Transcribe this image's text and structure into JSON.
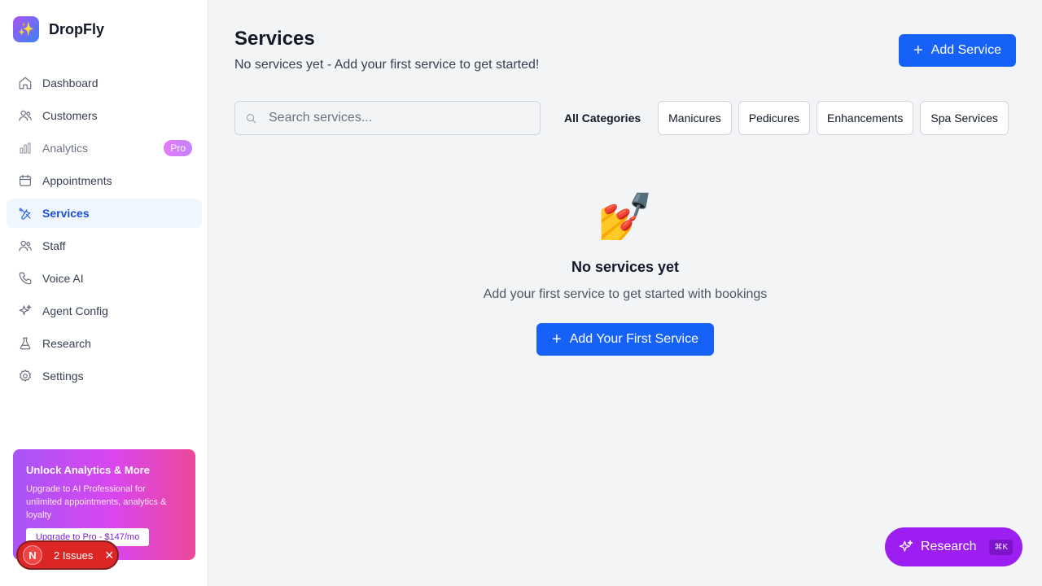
{
  "app": {
    "name": "DropFly",
    "logo_icon": "sparkles-icon"
  },
  "sidebar": {
    "items": [
      {
        "label": "Dashboard",
        "icon": "home-icon"
      },
      {
        "label": "Customers",
        "icon": "users-icon"
      },
      {
        "label": "Analytics",
        "icon": "bar-chart-icon",
        "badge": "Pro"
      },
      {
        "label": "Appointments",
        "icon": "calendar-icon"
      },
      {
        "label": "Services",
        "icon": "tools-icon",
        "active": true
      },
      {
        "label": "Staff",
        "icon": "users-icon"
      },
      {
        "label": "Voice AI",
        "icon": "phone-icon"
      },
      {
        "label": "Agent Config",
        "icon": "sparkles-icon"
      },
      {
        "label": "Research",
        "icon": "flask-icon"
      },
      {
        "label": "Settings",
        "icon": "gear-icon"
      }
    ],
    "upgrade": {
      "title": "Unlock Analytics & More",
      "text": "Upgrade to AI Professional for unlimited appointments, analytics & loyalty",
      "button": "Upgrade to Pro - $147/mo"
    },
    "issues": {
      "avatar": "N",
      "label": "2 Issues",
      "close": "✕"
    }
  },
  "header": {
    "title": "Services",
    "subtitle": "No services yet - Add your first service to get started!",
    "add_button": "Add Service"
  },
  "search": {
    "placeholder": "Search services..."
  },
  "filters": [
    "All Categories",
    "Manicures",
    "Pedicures",
    "Enhancements",
    "Spa Services"
  ],
  "empty": {
    "emoji": "💅",
    "title": "No services yet",
    "text": "Add your first service to get started with bookings",
    "button": "Add Your First Service"
  },
  "research_button": {
    "label": "Research",
    "shortcut": "⌘K"
  },
  "colors": {
    "primary": "#1662f8",
    "active_bg": "#eff6ff",
    "research": "#9d1ef0",
    "danger": "#dc2626"
  }
}
